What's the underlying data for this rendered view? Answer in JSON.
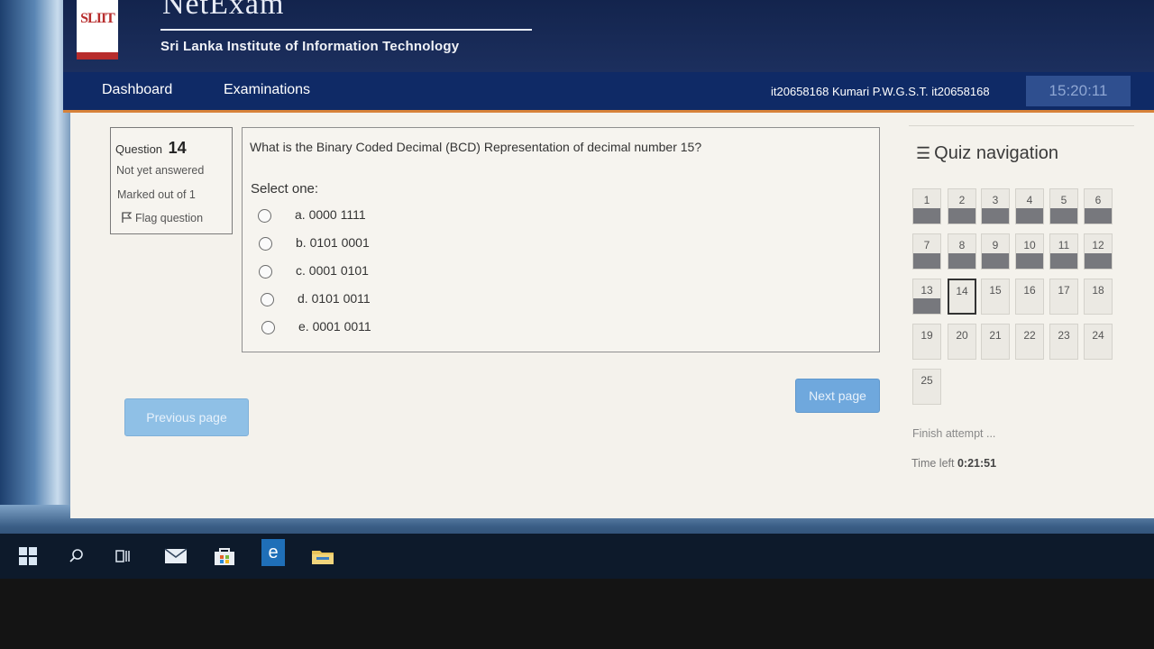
{
  "header": {
    "app_name": "NetExam",
    "logo_text": "SLIIT",
    "institution": "Sri Lanka Institute of Information Technology"
  },
  "navbar": {
    "dashboard": "Dashboard",
    "examinations": "Examinations",
    "user": "it20658168 Kumari P.W.G.S.T. it20658168",
    "clock": "15:20:11"
  },
  "question_info": {
    "label": "Question",
    "number": "14",
    "status": "Not yet answered",
    "marked": "Marked out of 1",
    "flag": "Flag question"
  },
  "question": {
    "text": "What is the Binary Coded Decimal (BCD) Representation of decimal number 15?",
    "select_one": "Select one:",
    "options": [
      "a. 0000 1111",
      "b. 0101 0001",
      "c. 0001 0101",
      "d. 0101 0011",
      "e. 0001 0011"
    ]
  },
  "buttons": {
    "previous": "Previous page",
    "next": "Next page"
  },
  "quiz_nav": {
    "title": "Quiz navigation",
    "questions": [
      {
        "n": "1",
        "answered": true
      },
      {
        "n": "2",
        "answered": true
      },
      {
        "n": "3",
        "answered": true
      },
      {
        "n": "4",
        "answered": true
      },
      {
        "n": "5",
        "answered": true
      },
      {
        "n": "6",
        "answered": true
      },
      {
        "n": "7",
        "answered": true
      },
      {
        "n": "8",
        "answered": true
      },
      {
        "n": "9",
        "answered": true
      },
      {
        "n": "10",
        "answered": true
      },
      {
        "n": "11",
        "answered": true
      },
      {
        "n": "12",
        "answered": true
      },
      {
        "n": "13",
        "answered": true
      },
      {
        "n": "14",
        "answered": false,
        "current": true
      },
      {
        "n": "15",
        "answered": false
      },
      {
        "n": "16",
        "answered": false
      },
      {
        "n": "17",
        "answered": false
      },
      {
        "n": "18",
        "answered": false
      },
      {
        "n": "19",
        "answered": false
      },
      {
        "n": "20",
        "answered": false
      },
      {
        "n": "21",
        "answered": false
      },
      {
        "n": "22",
        "answered": false
      },
      {
        "n": "23",
        "answered": false
      },
      {
        "n": "24",
        "answered": false
      },
      {
        "n": "25",
        "answered": false
      }
    ],
    "finish": "Finish attempt ...",
    "time_left_label": "Time left",
    "time_left": "0:21:51"
  },
  "taskbar": {
    "icons": [
      "windows-start-icon",
      "search-icon",
      "task-view-icon",
      "mail-icon",
      "store-icon",
      "edge-browser-icon",
      "file-explorer-icon"
    ]
  }
}
